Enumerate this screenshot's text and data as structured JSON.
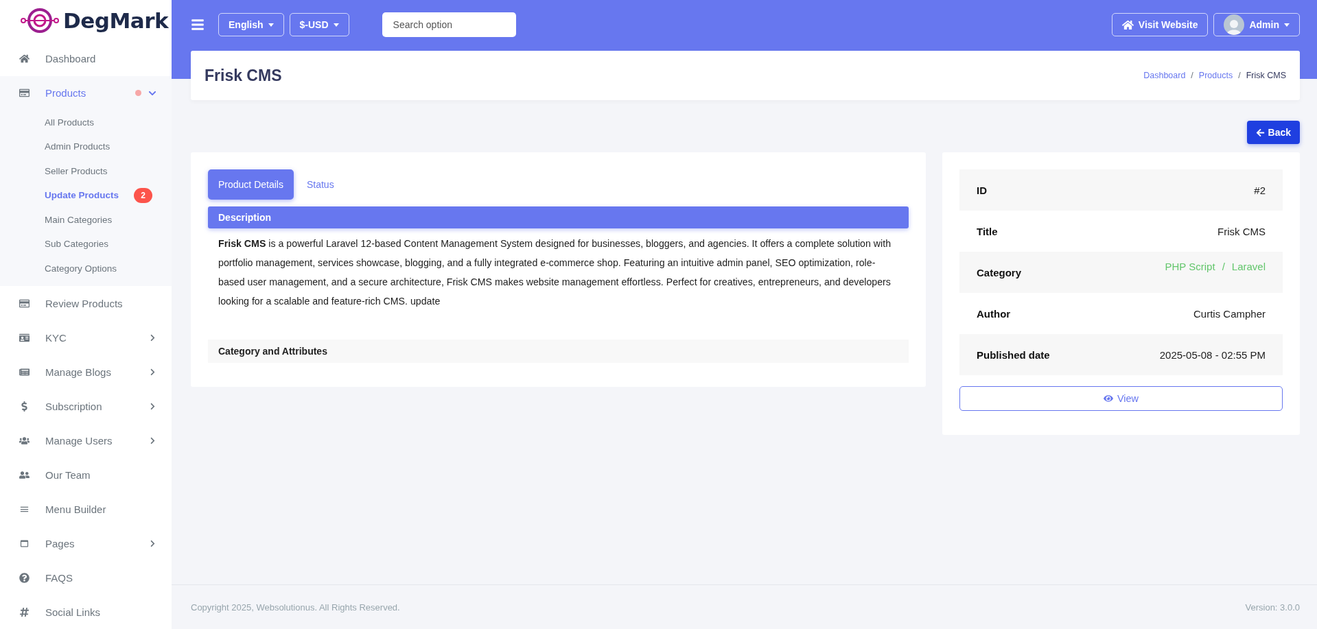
{
  "brand": {
    "name": "DegMark"
  },
  "sidebar": {
    "items": [
      {
        "label": "Dashboard",
        "kind": "link",
        "selected": false
      },
      {
        "label": "Products",
        "kind": "group",
        "selected": true,
        "expanded": true,
        "notice": true,
        "children": [
          {
            "label": "All Products",
            "selected": false
          },
          {
            "label": "Admin Products",
            "selected": false
          },
          {
            "label": "Seller Products",
            "selected": false
          },
          {
            "label": "Update Products",
            "selected": true,
            "badge": "2"
          },
          {
            "label": "Main Categories",
            "selected": false
          },
          {
            "label": "Sub Categories",
            "selected": false
          },
          {
            "label": "Category Options",
            "selected": false
          }
        ]
      },
      {
        "label": "Review Products",
        "kind": "link",
        "selected": false
      },
      {
        "label": "KYC",
        "kind": "group",
        "selected": false,
        "expanded": false
      },
      {
        "label": "Manage Blogs",
        "kind": "group",
        "selected": false,
        "expanded": false
      },
      {
        "label": "Subscription",
        "kind": "group",
        "selected": false,
        "expanded": false
      },
      {
        "label": "Manage Users",
        "kind": "group",
        "selected": false,
        "expanded": false
      },
      {
        "label": "Our Team",
        "kind": "link",
        "selected": false
      },
      {
        "label": "Menu Builder",
        "kind": "link",
        "selected": false
      },
      {
        "label": "Pages",
        "kind": "group",
        "selected": false,
        "expanded": false
      },
      {
        "label": "FAQS",
        "kind": "link",
        "selected": false
      },
      {
        "label": "Social Links",
        "kind": "link",
        "selected": false
      }
    ]
  },
  "topbar": {
    "language": "English",
    "currency": "$-USD",
    "search": {
      "placeholder": "Search option"
    },
    "visit_website": "Visit Website",
    "user": "Admin"
  },
  "page": {
    "title": "Frisk CMS",
    "breadcrumb_separator": "/",
    "breadcrumb": [
      {
        "label": "Dashboard",
        "kind": "link"
      },
      {
        "label": "Products",
        "kind": "link"
      },
      {
        "label": "Frisk CMS",
        "kind": "current"
      }
    ],
    "back": "Back"
  },
  "details": {
    "tabs": [
      {
        "label": "Product Details",
        "selected": true
      },
      {
        "label": "Status",
        "selected": false
      }
    ],
    "description_heading": "Description",
    "description": "**Frisk CMS** is a powerful Laravel 12-based Content Management System designed for businesses, bloggers, and agencies. It offers a complete solution with portfolio management, services showcase, blogging, and a fully integrated e-commerce shop. Featuring an intuitive admin panel, SEO optimization, role-based user management, and a secure architecture, Frisk CMS makes website management effortless. Perfect for creatives, entrepreneurs, and developers looking for a scalable and feature-rich CMS. update",
    "attributes_heading": "Category and Attributes"
  },
  "info": {
    "rows": [
      {
        "label": "ID",
        "kind": "text",
        "value": "#2"
      },
      {
        "label": "Title",
        "kind": "text",
        "value": "Frisk CMS"
      },
      {
        "label": "Category",
        "kind": "links",
        "links": [
          "PHP Script",
          "Laravel"
        ],
        "separator": "/"
      },
      {
        "label": "Author",
        "kind": "text",
        "value": "Curtis Campher"
      },
      {
        "label": "Published date",
        "kind": "text",
        "value": "2025-05-08 - 02:55 PM"
      }
    ],
    "view": "View"
  },
  "footer": {
    "copyright": "Copyright 2025, Websolutionus. All Rights Reserved.",
    "version": "Version: 3.0.0"
  }
}
